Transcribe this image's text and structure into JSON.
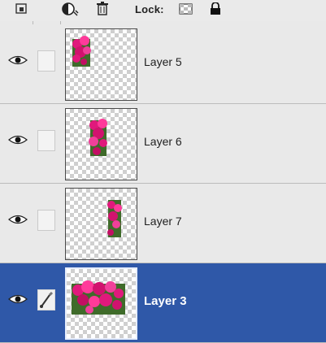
{
  "toolbar": {
    "lock_label": "Lock:",
    "icons": [
      "link-layers-icon",
      "adjustment-layer-icon",
      "trash-icon",
      "lock-transparent-pixels-icon",
      "lock-all-icon"
    ]
  },
  "layers": [
    {
      "name": "Layer 5",
      "visible": true,
      "selected": false
    },
    {
      "name": "Layer 6",
      "visible": true,
      "selected": false
    },
    {
      "name": "Layer 7",
      "visible": true,
      "selected": false
    },
    {
      "name": "Layer 3",
      "visible": true,
      "selected": true
    }
  ],
  "colors": {
    "selected_row": "#2f58a8",
    "flower_magenta": "#e0197c"
  }
}
